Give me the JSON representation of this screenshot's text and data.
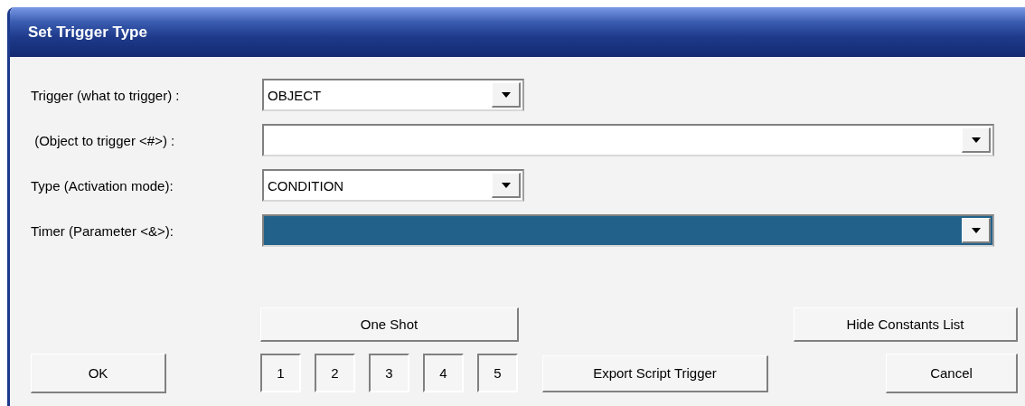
{
  "window": {
    "title": "Set Trigger Type"
  },
  "fields": [
    {
      "label": "Trigger (what to trigger) :",
      "value": "OBJECT",
      "wide": false,
      "highlighted": false
    },
    {
      "label": " (Object to trigger <#>) :",
      "wide": true,
      "highlighted": false
    },
    {
      "label": "Type (Activation mode):",
      "value": "CONDITION",
      "wide": false,
      "highlighted": false
    },
    {
      "label": "Timer (Parameter <&>):",
      "wide": true,
      "highlighted": true
    }
  ],
  "buttons": {
    "one_shot": "One Shot",
    "hide_constants": "Hide Constants List",
    "ok": "OK",
    "export": "Export Script Trigger",
    "cancel": "Cancel"
  },
  "number_boxes": [
    "1",
    "2",
    "3",
    "4",
    "5"
  ]
}
